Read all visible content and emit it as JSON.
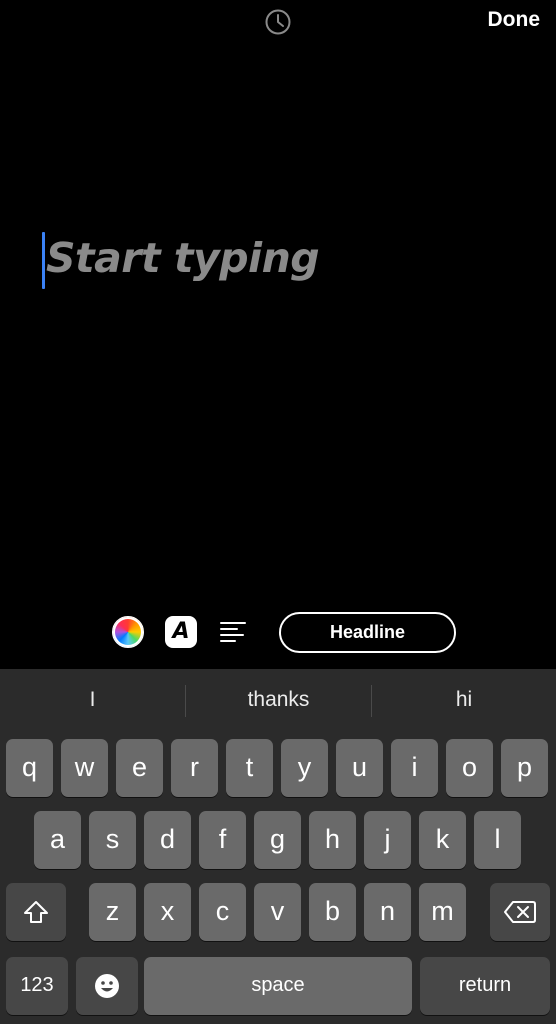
{
  "header": {
    "timer_icon": "clock-icon",
    "done_label": "Done"
  },
  "editor": {
    "placeholder": "Start typing"
  },
  "toolbar": {
    "color_icon": "color-wheel-icon",
    "font_label": "A",
    "align_icon": "text-align-left-icon",
    "style_label": "Headline"
  },
  "keyboard": {
    "suggestions": [
      "I",
      "thanks",
      "hi"
    ],
    "row1": [
      "q",
      "w",
      "e",
      "r",
      "t",
      "y",
      "u",
      "i",
      "o",
      "p"
    ],
    "row2": [
      "a",
      "s",
      "d",
      "f",
      "g",
      "h",
      "j",
      "k",
      "l"
    ],
    "row3": [
      "z",
      "x",
      "c",
      "v",
      "b",
      "n",
      "m"
    ],
    "shift_icon": "shift-icon",
    "delete_icon": "backspace-icon",
    "numbers_label": "123",
    "emoji_icon": "emoji-icon",
    "space_label": "space",
    "return_label": "return"
  },
  "colors": {
    "caret": "#3b82f6",
    "placeholder": "#8a8a8a",
    "keyboard_bg": "#2b2b2b",
    "key": "#6a6a6a",
    "key_dark": "#474747"
  }
}
